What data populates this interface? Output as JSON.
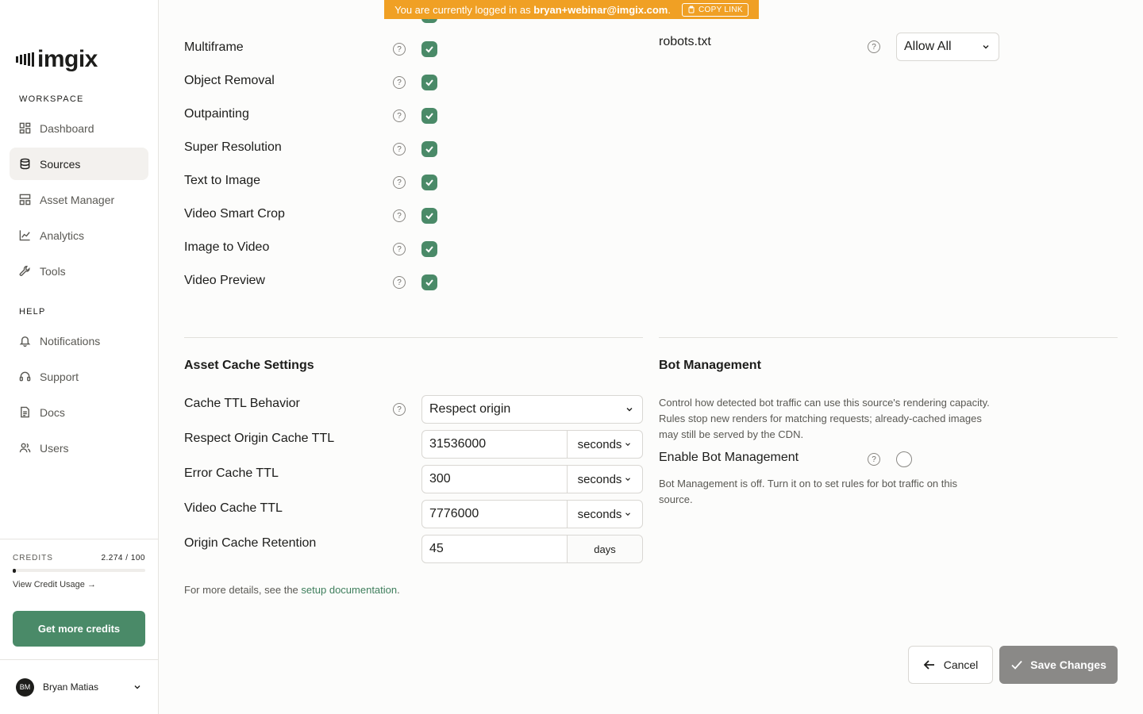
{
  "banner": {
    "prefix": "You are currently logged in as",
    "email": "bryan+webinar@imgix.com",
    "suffix": ".",
    "copy_label": "COPY LINK"
  },
  "sidebar": {
    "logo": "imgix",
    "workspace_label": "WORKSPACE",
    "workspace_items": [
      {
        "label": "Dashboard",
        "icon": "grid-icon"
      },
      {
        "label": "Sources",
        "icon": "database-icon",
        "active": true
      },
      {
        "label": "Asset Manager",
        "icon": "layout-icon"
      },
      {
        "label": "Analytics",
        "icon": "chart-icon"
      },
      {
        "label": "Tools",
        "icon": "wrench-icon"
      }
    ],
    "help_label": "HELP",
    "help_items": [
      {
        "label": "Notifications",
        "icon": "bell-icon"
      },
      {
        "label": "Support",
        "icon": "headset-icon"
      },
      {
        "label": "Docs",
        "icon": "document-icon"
      },
      {
        "label": "Users",
        "icon": "users-icon"
      }
    ],
    "credits": {
      "label": "CREDITS",
      "value": "2.274 / 100",
      "fill_fraction": 0.02,
      "usage_link": "View Credit Usage →",
      "cta": "Get more credits"
    },
    "user": {
      "initials": "BM",
      "name": "Bryan Matias"
    }
  },
  "features": [
    {
      "label": "Multiframe",
      "enabled": true
    },
    {
      "label": "Object Removal",
      "enabled": true
    },
    {
      "label": "Outpainting",
      "enabled": true
    },
    {
      "label": "Super Resolution",
      "enabled": true
    },
    {
      "label": "Text to Image",
      "enabled": true
    },
    {
      "label": "Video Smart Crop",
      "enabled": true
    },
    {
      "label": "Image to Video",
      "enabled": true
    },
    {
      "label": "Video Preview",
      "enabled": true
    }
  ],
  "robots": {
    "label": "robots.txt",
    "value": "Allow All"
  },
  "cache": {
    "heading": "Asset Cache Settings",
    "behavior_label": "Cache TTL Behavior",
    "behavior_value": "Respect origin",
    "rows": [
      {
        "label": "Respect Origin Cache TTL",
        "value": "31536000",
        "unit": "seconds"
      },
      {
        "label": "Error Cache TTL",
        "value": "300",
        "unit": "seconds"
      },
      {
        "label": "Video Cache TTL",
        "value": "7776000",
        "unit": "seconds"
      }
    ],
    "retention_label": "Origin Cache Retention",
    "retention_value": "45",
    "retention_unit": "days",
    "note_prefix": "For more details, see the",
    "note_link": "setup documentation",
    "note_suffix": "."
  },
  "bot": {
    "heading": "Bot Management",
    "description": "Control how detected bot traffic can use this source's rendering capacity. Rules stop new renders for matching requests; already-cached images may still be served by the CDN.",
    "enable_label": "Enable Bot Management",
    "enabled": false,
    "status": "Bot Management is off. Turn it on to set rules for bot traffic on this source."
  },
  "actions": {
    "cancel": "Cancel",
    "save": "Save Changes"
  },
  "colors": {
    "accent": "#4a8a68",
    "banner": "#f0a024",
    "save_disabled": "#8a8987"
  }
}
